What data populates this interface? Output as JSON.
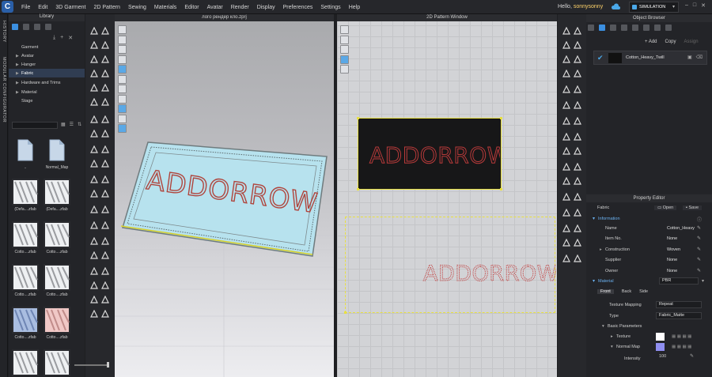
{
  "menubar": {
    "logo_letter": "C",
    "items": [
      "File",
      "Edit",
      "3D Garment",
      "2D Pattern",
      "Sewing",
      "Materials",
      "Editor",
      "Avatar",
      "Render",
      "Display",
      "Preferences",
      "Settings",
      "Help"
    ],
    "hello_prefix": "Hello, ",
    "username": "sonnysonny",
    "mode": "SIMULATION",
    "window_controls": [
      "–",
      "□",
      "✕"
    ]
  },
  "side_strips": {
    "history": "HISTORY",
    "modular": "MODULAR CONFIGURATOR"
  },
  "library": {
    "title": "Library",
    "tree": [
      {
        "label": "Garment",
        "arrow": false,
        "selected": false
      },
      {
        "label": "Avatar",
        "arrow": true,
        "selected": false
      },
      {
        "label": "Hanger",
        "arrow": true,
        "selected": false
      },
      {
        "label": "Fabric",
        "arrow": true,
        "selected": true
      },
      {
        "label": "Hardware and Trims",
        "arrow": true,
        "selected": false
      },
      {
        "label": "Material",
        "arrow": true,
        "selected": false
      },
      {
        "label": "Stage",
        "arrow": false,
        "selected": false
      }
    ],
    "thumbnails": [
      {
        "label": "..",
        "kind": "folder"
      },
      {
        "label": "Normal_Map",
        "kind": "folder"
      },
      {
        "label": "(Defa....zfab",
        "kind": "white"
      },
      {
        "label": "(Defa....zfab",
        "kind": "white"
      },
      {
        "label": "Cotto....zfab",
        "kind": "white"
      },
      {
        "label": "Cotto....zfab",
        "kind": "white"
      },
      {
        "label": "Cotto....zfab",
        "kind": "white"
      },
      {
        "label": "Cotto....zfab",
        "kind": "white"
      },
      {
        "label": "Cotto....zfab",
        "kind": "blue"
      },
      {
        "label": "Cotto....zfab",
        "kind": "pink"
      },
      {
        "label": "",
        "kind": "white"
      },
      {
        "label": "",
        "kind": "white"
      }
    ]
  },
  "viewport3d": {
    "title": "лого рендер кло.zprj",
    "text": "ADDORROW"
  },
  "pattern2d": {
    "title": "2D Pattern Window",
    "text_top": "ADDORROW",
    "text_bottom": "ADDORROW"
  },
  "object_browser": {
    "title": "Object Browser",
    "add_label": "+ Add",
    "copy_label": "Copy",
    "assign_label": "Assign",
    "item_name": "Cotton_Heavy_Twill"
  },
  "property_editor": {
    "title": "Property Editor",
    "header_label": "Fabric",
    "open_label": "Open",
    "save_label": "Save",
    "information_label": "Information",
    "fields": [
      {
        "key": "Name",
        "value": "Cotton_Heavy"
      },
      {
        "key": "Item No.",
        "value": "None"
      },
      {
        "key": "Construction",
        "value": "Woven"
      },
      {
        "key": "Supplier",
        "value": "None"
      },
      {
        "key": "Owner",
        "value": "None"
      }
    ],
    "material_label": "Material",
    "material_value": "PBR",
    "subtabs": [
      "Front",
      "Back",
      "Side"
    ],
    "texture_mapping_label": "Texture Mapping",
    "texture_mapping_value": "Repeat",
    "type_label": "Type",
    "type_value": "Fabric_Matte",
    "basic_params_label": "Basic Parameters",
    "texture_label": "Texture",
    "normal_map_label": "Normal Map",
    "intensity_label": "Intensity",
    "intensity_value": "100",
    "colors": {
      "texture_swatch": "#ffffff",
      "normal_swatch": "#8f8ef0"
    }
  },
  "colors": {
    "accent": "#4aa8e8",
    "selection": "#e8e040",
    "stitch": "#b83a3a"
  }
}
